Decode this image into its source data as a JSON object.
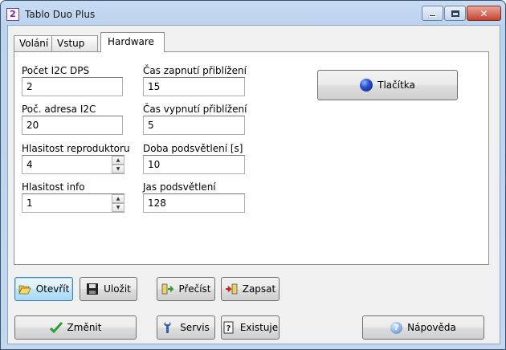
{
  "window": {
    "title": "Tablo Duo Plus",
    "icon_name": "app-icon-2"
  },
  "tabs": [
    {
      "label": "Volání",
      "active": false
    },
    {
      "label": "Vstup",
      "active": false
    },
    {
      "label": "Hardware",
      "active": true
    }
  ],
  "fields": {
    "pocet_i2c_dps": {
      "label": "Počet I2C DPS",
      "value": "2"
    },
    "poc_adresa_i2c": {
      "label": "Poč. adresa I2C",
      "value": "20"
    },
    "hlasitost_reproduktoru": {
      "label": "Hlasitost reproduktoru",
      "value": "4"
    },
    "hlasitost_info": {
      "label": "Hlasitost info",
      "value": "1"
    },
    "cas_zapnuti": {
      "label": "Čas zapnutí přiblížení",
      "value": "15"
    },
    "cas_vypnuti": {
      "label": "Čas vypnutí přiblížení",
      "value": "5"
    },
    "doba_podsvetleni": {
      "label": "Doba podsvětlení [s]",
      "value": "10"
    },
    "jas_podsvetleni": {
      "label": "Jas podsvětlení",
      "value": "128"
    }
  },
  "buttons": {
    "tlacitka": "Tlačítka",
    "otevrit": "Otevřít",
    "ulozit": "Uložit",
    "precist": "Přečíst",
    "zapsat": "Zapsat",
    "zmenit": "Změnit",
    "servis": "Servis",
    "existuje": "Existuje",
    "napoveda": "Nápověda"
  },
  "icons": {
    "tlacitka": "blue-sphere-icon",
    "otevrit": "open-folder-icon",
    "ulozit": "floppy-disk-icon",
    "precist": "read-device-icon",
    "zapsat": "write-device-icon",
    "zmenit": "checkmark-icon",
    "servis": "wrench-icon",
    "existuje": "question-document-icon",
    "napoveda": "help-icon"
  },
  "colors": {
    "checkmark": "#2aa12a",
    "sphere": "#2a4fd6",
    "focus": "#3c7fb1"
  }
}
